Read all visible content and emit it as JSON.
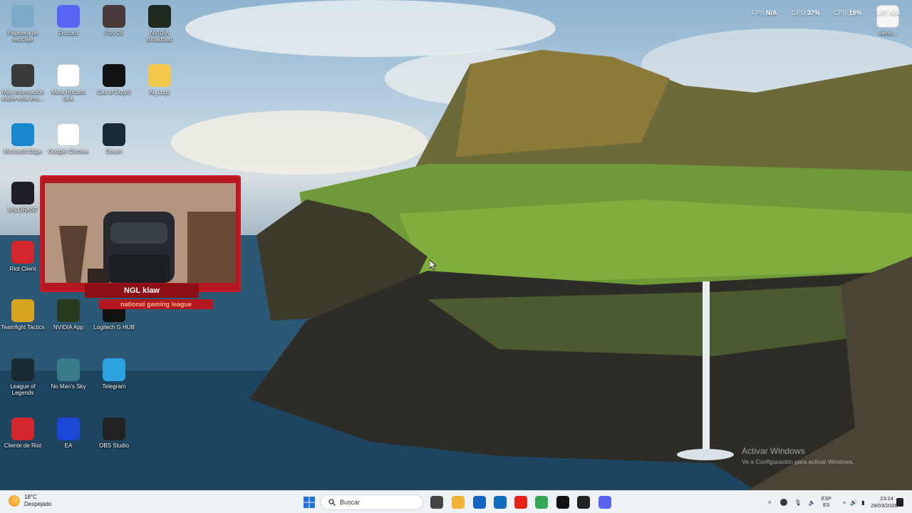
{
  "desktop": {
    "icons": [
      {
        "label": "Papelera de reciclaje",
        "icon": "recycle-bin-icon",
        "color": "#7fa9c9"
      },
      {
        "label": "Discord",
        "icon": "discord-icon",
        "color": "#5865f2"
      },
      {
        "label": "F1® 25",
        "icon": "f1-icon",
        "color": "#4a3a3a"
      },
      {
        "label": "NVIDIA Broadcast",
        "icon": "nvidia-broadcast-icon",
        "color": "#1f2a1f"
      },
      {
        "label": "Más información sobre esta ima...",
        "icon": "info-camera-icon",
        "color": "#3a3a3a"
      },
      {
        "label": "Meta Horizon Link",
        "icon": "meta-icon",
        "color": "#ffffff"
      },
      {
        "label": "Call of Duty®",
        "icon": "cod-icon",
        "color": "#111111"
      },
      {
        "label": "AI_Logs",
        "icon": "folder-icon",
        "color": "#f2c94c"
      },
      {
        "label": "Microsoft Edge",
        "icon": "edge-icon",
        "color": "#1a86d0"
      },
      {
        "label": "Google Chrome",
        "icon": "chrome-icon",
        "color": "#ffffff"
      },
      {
        "label": "Steam",
        "icon": "steam-icon",
        "color": "#1b2838"
      },
      {
        "label": "VALORANT",
        "icon": "valorant-icon",
        "color": "#1f1f2a"
      },
      {
        "label": "Riot Client",
        "icon": "riot-icon",
        "color": "#d3262e"
      },
      {
        "label": "Teamfight Tactics",
        "icon": "tft-icon",
        "color": "#d9a520"
      },
      {
        "label": "NVIDIA App",
        "icon": "nvidia-icon",
        "color": "#2a3a1f"
      },
      {
        "label": "Logitech G HUB",
        "icon": "logitech-icon",
        "color": "#111111"
      },
      {
        "label": "League of Legends",
        "icon": "lol-icon",
        "color": "#1a2a30"
      },
      {
        "label": "No Man's Sky",
        "icon": "nms-icon",
        "color": "#3a7a8a"
      },
      {
        "label": "Telegram",
        "icon": "telegram-icon",
        "color": "#2aa3df"
      },
      {
        "label": "Cliente de Riot",
        "icon": "riot-client-icon",
        "color": "#d3262e"
      },
      {
        "label": "EA",
        "icon": "ea-icon",
        "color": "#1b47d6"
      },
      {
        "label": "OBS Studio",
        "icon": "obs-icon",
        "color": "#222222"
      },
      {
        "label": "viene...",
        "icon": "document-icon",
        "color": "#f5f5f5"
      }
    ]
  },
  "overlay": {
    "fps_label": "FPS",
    "fps_value": "N/A",
    "gpu_label": "GPU",
    "gpu_value": "37",
    "cpu_label": "CPU",
    "cpu_value": "19",
    "lat_label": "LAT",
    "lat_value": "N/A"
  },
  "webcam": {
    "name": "NGL klaw",
    "tagline": "national gaming league"
  },
  "watermark": {
    "title": "Activar Windows",
    "subtitle": "Ve a Configuración para activar Windows."
  },
  "taskbar": {
    "weather_temp": "18°C",
    "weather_desc": "Despejado",
    "search_placeholder": "Buscar",
    "apps": [
      {
        "icon": "windows-start-icon",
        "color": "#1f73d6"
      },
      {
        "icon": "task-view-icon",
        "color": "#444444"
      },
      {
        "icon": "file-explorer-icon",
        "color": "#f2b233"
      },
      {
        "icon": "store-icon",
        "color": "#1565c0"
      },
      {
        "icon": "outlook-icon",
        "color": "#0f6cbd"
      },
      {
        "icon": "youtube-icon",
        "color": "#e62117"
      },
      {
        "icon": "chrome-icon",
        "color": "#34a853"
      },
      {
        "icon": "capcut-icon",
        "color": "#111111"
      },
      {
        "icon": "obs-icon",
        "color": "#222222"
      },
      {
        "icon": "discord-icon",
        "color": "#5865f2"
      }
    ],
    "lang_line1": "ESP",
    "lang_line2": "ES",
    "time": "23:24",
    "date": "29/03/2026"
  }
}
